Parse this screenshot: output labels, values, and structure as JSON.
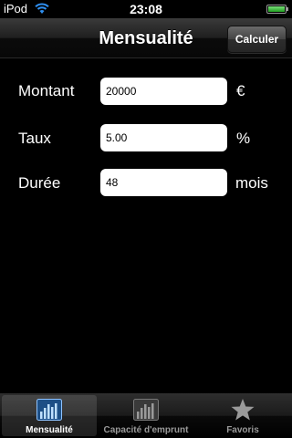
{
  "status_bar": {
    "carrier": "iPod",
    "time": "23:08",
    "wifi_icon": "wifi-icon",
    "battery_icon": "battery-icon"
  },
  "nav": {
    "title": "Mensualité",
    "button": "Calculer"
  },
  "form": {
    "montant": {
      "label": "Montant",
      "value": "20000",
      "unit": "€"
    },
    "taux": {
      "label": "Taux",
      "value": "5.00",
      "unit": "%"
    },
    "duree": {
      "label": "Durée",
      "value": "48",
      "unit": "mois"
    }
  },
  "tabs": [
    {
      "label": "Mensualité",
      "icon": "bar-chart-icon",
      "selected": true
    },
    {
      "label": "Capacité d'emprunt",
      "icon": "bar-chart-icon",
      "selected": false
    },
    {
      "label": "Favoris",
      "icon": "star-icon",
      "selected": false
    }
  ],
  "colors": {
    "background": "#000000",
    "selected_tab_icon": "#4a90d9"
  }
}
